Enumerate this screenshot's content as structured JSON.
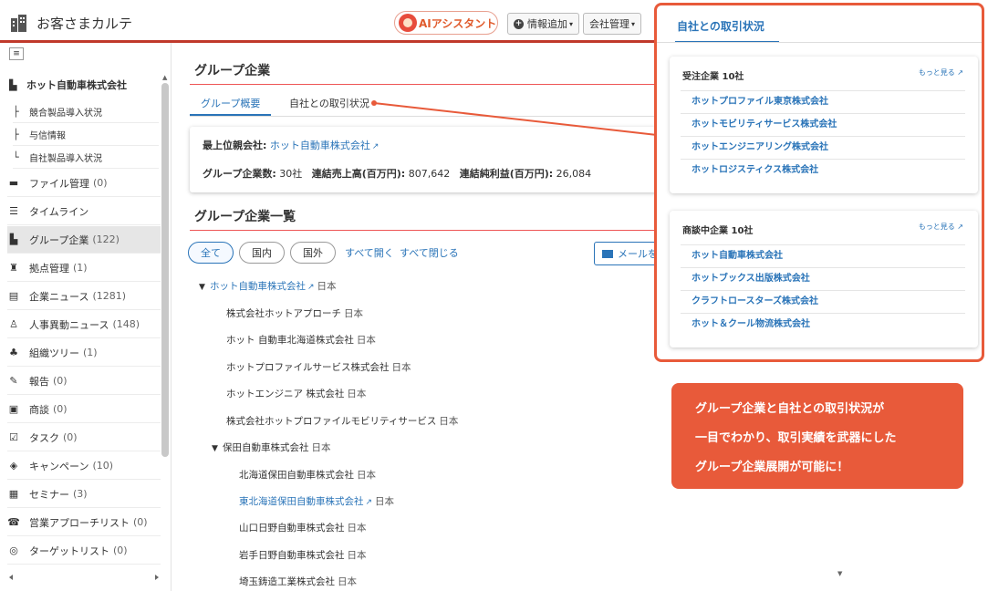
{
  "header": {
    "title": "お客さまカルテ",
    "ai_button": "AIアシスタント",
    "info_add": "情報追加",
    "company_mgmt": "会社管理"
  },
  "sidebar": {
    "toggle": "≡",
    "company": "ホット自動車株式会社",
    "sub_items": [
      "競合製品導入状況",
      "与信情報",
      "自社製品導入状況"
    ],
    "items": [
      {
        "label": "ファイル管理",
        "count": "(0)",
        "icon": "folder-icon"
      },
      {
        "label": "タイムライン",
        "count": "",
        "icon": "list-icon"
      },
      {
        "label": "グループ企業",
        "count": "(122)",
        "icon": "building-icon"
      },
      {
        "label": "拠点管理",
        "count": "(1)",
        "icon": "sitemap-icon"
      },
      {
        "label": "企業ニュース",
        "count": "(1281)",
        "icon": "news-icon"
      },
      {
        "label": "人事異動ニュース",
        "count": "(148)",
        "icon": "person-news-icon"
      },
      {
        "label": "組織ツリー",
        "count": "(1)",
        "icon": "org-tree-icon"
      },
      {
        "label": "報告",
        "count": "(0)",
        "icon": "report-icon"
      },
      {
        "label": "商談",
        "count": "(0)",
        "icon": "deal-icon"
      },
      {
        "label": "タスク",
        "count": "(0)",
        "icon": "checkbox-icon"
      },
      {
        "label": "キャンペーン",
        "count": "(10)",
        "icon": "campaign-icon"
      },
      {
        "label": "セミナー",
        "count": "(3)",
        "icon": "seminar-icon"
      },
      {
        "label": "営業アプローチリスト",
        "count": "(0)",
        "icon": "phone-icon"
      },
      {
        "label": "ターゲットリスト",
        "count": "(0)",
        "icon": "target-icon"
      }
    ]
  },
  "main": {
    "group_title": "グループ企業",
    "tabs": [
      "グループ概要",
      "自社との取引状況"
    ],
    "summary": {
      "top_parent_label": "最上位親会社:",
      "top_parent_name": "ホット自動車株式会社",
      "stats_label1": "グループ企業数:",
      "stats_value1": "30社",
      "stats_label2": "連結売上高(百万円):",
      "stats_value2": "807,642",
      "stats_label3": "連結純利益(百万円):",
      "stats_value3": "26,084"
    },
    "list_title": "グループ企業一覧",
    "filters": [
      "全て",
      "国内",
      "国外"
    ],
    "expand_all": "すべて開く",
    "collapse_all": "すべて閉じる",
    "mail_button": "メールを",
    "tree": [
      {
        "name": "ホット自動車株式会社",
        "country": "日本",
        "link": true,
        "expanded": true
      },
      {
        "name": "株式会社ホットアプローチ",
        "country": "日本",
        "link": false
      },
      {
        "name": "ホット 自動車北海道株式会社",
        "country": "日本",
        "link": false
      },
      {
        "name": "ホットプロファイルサービス株式会社",
        "country": "日本",
        "link": false
      },
      {
        "name": "ホットエンジニア 株式会社",
        "country": "日本",
        "link": false
      },
      {
        "name": "株式会社ホットプロファイルモビリティサービス",
        "country": "日本",
        "link": false
      },
      {
        "name": "保田自動車株式会社",
        "country": "日本",
        "link": false,
        "expanded": true
      },
      {
        "name": "北海道保田自動車株式会社",
        "country": "日本",
        "link": false
      },
      {
        "name": "東北海道保田自動車株式会社",
        "country": "日本",
        "link": true
      },
      {
        "name": "山口日野自動車株式会社",
        "country": "日本",
        "link": false
      },
      {
        "name": "岩手日野自動車株式会社",
        "country": "日本",
        "link": false
      },
      {
        "name": "埼玉鋳造工業株式会社",
        "country": "日本",
        "link": false
      }
    ]
  },
  "popup": {
    "tab": "自社との取引状況",
    "sections": [
      {
        "header": "受注企業 10社",
        "more": "もっと見る",
        "items": [
          "ホットプロファイル東京株式会社",
          "ホットモビリティサービス株式会社",
          "ホットエンジニアリング株式会社",
          "ホットロジスティクス株式会社"
        ]
      },
      {
        "header": "商談中企業 10社",
        "more": "もっと見る",
        "items": [
          "ホット自動車株式会社",
          "ホットブックス出版株式会社",
          "クラフトロースターズ株式会社",
          "ホット＆クール物流株式会社"
        ]
      }
    ]
  },
  "callout": {
    "lines": [
      "グループ企業と自社との取引状況が",
      "一目でわかり、取引実績を武器にした",
      "グループ企業展開が可能に！"
    ]
  },
  "colors": {
    "accent": "#e85a3a",
    "link": "#2a74b8",
    "header_rule": "#c0392b"
  }
}
